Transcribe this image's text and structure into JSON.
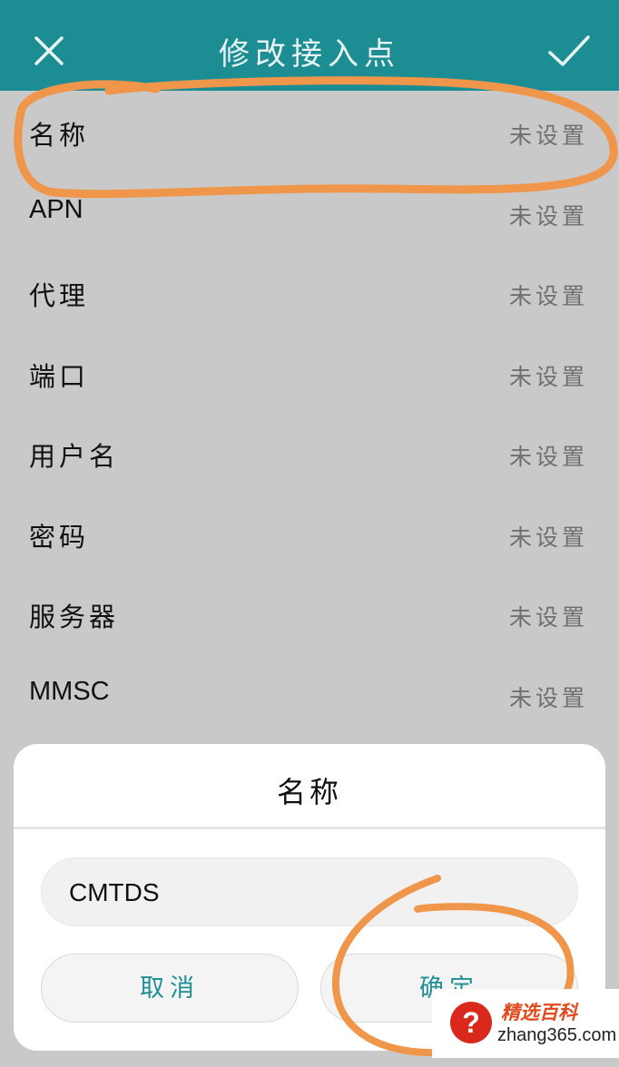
{
  "header": {
    "title": "修改接入点",
    "close_icon": "close-icon",
    "confirm_icon": "check-icon"
  },
  "fields": [
    {
      "label": "名称",
      "value": "未设置"
    },
    {
      "label": "APN",
      "value": "未设置"
    },
    {
      "label": "代理",
      "value": "未设置"
    },
    {
      "label": "端口",
      "value": "未设置"
    },
    {
      "label": "用户名",
      "value": "未设置"
    },
    {
      "label": "密码",
      "value": "未设置"
    },
    {
      "label": "服务器",
      "value": "未设置"
    },
    {
      "label": "MMSC",
      "value": "未设置"
    }
  ],
  "dialog": {
    "title": "名称",
    "input_value": "CMTDS",
    "cancel_label": "取消",
    "ok_label": "确定"
  },
  "watermark": {
    "brand": "精选百科",
    "url": "zhang365.com",
    "badge": "?"
  },
  "colors": {
    "header_bg": "#1c8d93",
    "accent": "#1f8f96",
    "overlay_bg": "#c9c9c9",
    "annotation": "#f0964a"
  }
}
